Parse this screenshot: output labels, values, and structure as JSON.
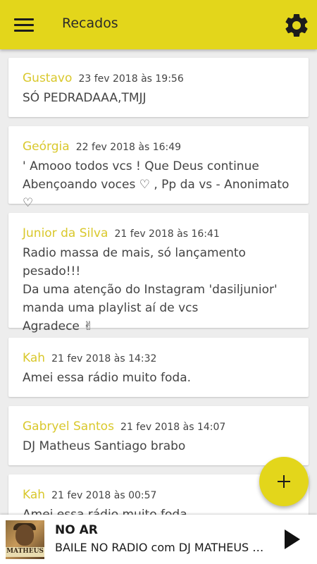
{
  "header": {
    "title": "Recados",
    "accent_color": "#e3d61b"
  },
  "icons": {
    "menu": "menu-icon",
    "settings": "gear-icon",
    "add": "plus-icon",
    "play": "play-icon"
  },
  "messages": [
    {
      "author": "Gustavo",
      "date": "23 fev 2018 às 19:56",
      "text": "SÓ PEDRADAAA,TMJJ"
    },
    {
      "author": "Geórgia",
      "date": "22 fev 2018 às 16:49",
      "text": "' Amooo todos vcs ! Que Deus continue\nAbençoando voces ♡ , Pp da vs - Anonimato ♡"
    },
    {
      "author": "Junior da Silva",
      "date": "21 fev 2018 às 16:41",
      "text": "Radio massa de mais, só lançamento pesado!!!\nDa uma atenção do Instagram 'dasiljunior'\nmanda uma playlist aí de vcs\nAgradece ✌"
    },
    {
      "author": "Kah",
      "date": "21 fev 2018 às 14:32",
      "text": "Amei essa rádio muito foda."
    },
    {
      "author": "Gabryel Santos",
      "date": "21 fev 2018 às 14:07",
      "text": "DJ Matheus Santiago brabo"
    },
    {
      "author": "Kah",
      "date": "21 fev 2018 às 00:57",
      "text": "Amei essa rádio muito foda."
    }
  ],
  "player": {
    "status": "NO AR",
    "now_playing": "BAILE NO RADIO com DJ MATHEUS SANTIAGO",
    "cover_text": "MATHEUS"
  }
}
